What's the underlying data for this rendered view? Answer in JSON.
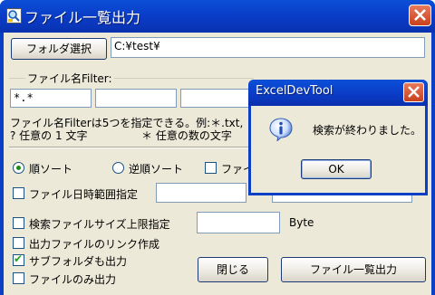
{
  "window": {
    "title": "ファイル一覧出力"
  },
  "folder": {
    "button_label": "フォルダ選択",
    "path_value": "C:¥test¥"
  },
  "filter": {
    "group_label": "ファイル名Filter:",
    "values": [
      "*.*",
      "",
      "",
      "",
      ""
    ],
    "help_line1": "ファイル名Filterは5つを指定できる。例:＊.txt,",
    "help_line2_a": "? 任意の 1 文字",
    "help_line2_b": "＊ 任意の数の文字"
  },
  "options": {
    "sort_asc_label": "順ソート",
    "sort_desc_label": "逆順ソート",
    "third_check_label": "ファイ",
    "date_range_label": "ファイル日時範囲指定",
    "size_limit_label": "検索ファイルサイズ上限指定",
    "size_unit": "Byte",
    "link_label": "出力ファイルのリンク作成",
    "subfolder_label": "サブフォルダも出力",
    "files_only_label": "ファイルのみ出力",
    "sort_asc_selected": true,
    "subfolder_checked": true
  },
  "buttons": {
    "close_label": "閉じる",
    "export_label": "ファイル一覧出力"
  },
  "message_box": {
    "title": "ExcelDevTool",
    "message": "検索が終わりました。",
    "ok_label": "OK"
  },
  "colors": {
    "title_bar": "#0a3fc6",
    "dialog_face": "#ece9d8",
    "close_red": "#c9401d"
  },
  "icons": {
    "app": "folder-search-icon",
    "close": "close-icon",
    "info": "info-icon"
  }
}
